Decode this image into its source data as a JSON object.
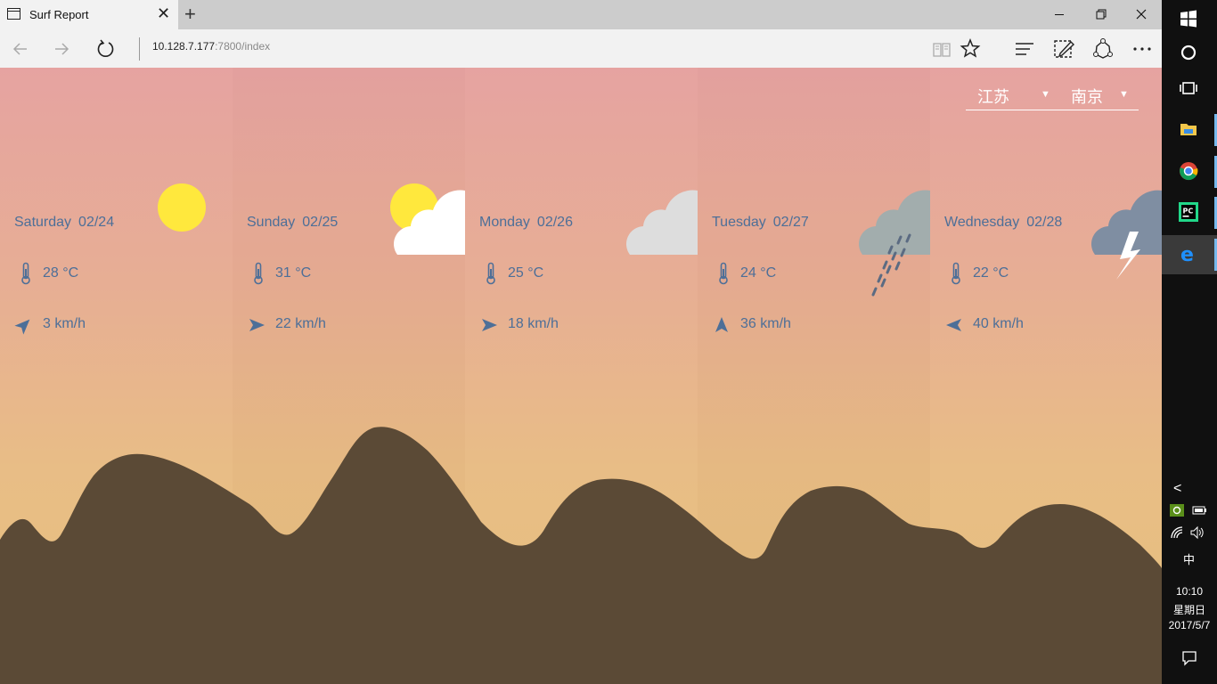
{
  "browser": {
    "tab_title": "Surf Report",
    "tab_close": "✕",
    "new_tab": "+",
    "address_host": "10.128.7.177",
    "address_rest": ":7800/index",
    "window_controls": {
      "minimize": "—",
      "maximize": "❐",
      "close": "✕"
    },
    "icons": [
      "back-icon",
      "forward-icon",
      "refresh-icon",
      "reading-view-icon",
      "favorites-star-icon",
      "hub-icon",
      "web-note-icon",
      "share-icon",
      "more-icon"
    ]
  },
  "location": {
    "province": "江苏",
    "city": "南京",
    "dropdown_glyph": "▼"
  },
  "days": [
    {
      "weekday": "Saturday",
      "date": "02/24",
      "temp": "28 °C",
      "wind": "3 km/h",
      "icon": "sun-icon",
      "wind_dir": "north-east"
    },
    {
      "weekday": "Sunday",
      "date": "02/25",
      "temp": "31 °C",
      "wind": "22 km/h",
      "icon": "partly-cloudy-icon",
      "wind_dir": "east"
    },
    {
      "weekday": "Monday",
      "date": "02/26",
      "temp": "25 °C",
      "wind": "18 km/h",
      "icon": "cloud-icon",
      "wind_dir": "east"
    },
    {
      "weekday": "Tuesday",
      "date": "02/27",
      "temp": "24 °C",
      "wind": "36 km/h",
      "icon": "rain-cloud-icon",
      "wind_dir": "north"
    },
    {
      "weekday": "Wednesday",
      "date": "02/28",
      "temp": "22 °C",
      "wind": "40 km/h",
      "icon": "thunder-cloud-icon",
      "wind_dir": "west"
    }
  ],
  "colors": {
    "text": "#4d6f98",
    "sun": "#ffe83d",
    "mountain": "#5b4a36",
    "cloud": "#ffffff",
    "grey_cloud": "#dddddd",
    "rain_cloud": "#a2adad",
    "storm_cloud": "#7f8ea2"
  },
  "taskbar": {
    "tray_up": "<",
    "ime": "中",
    "time": "10:10",
    "weekday": "星期日",
    "date": "2017/5/7",
    "icons": [
      "windows-start-icon",
      "cortana-icon",
      "task-view-icon",
      "file-explorer-icon",
      "chrome-icon",
      "pycharm-icon",
      "edge-icon"
    ]
  }
}
